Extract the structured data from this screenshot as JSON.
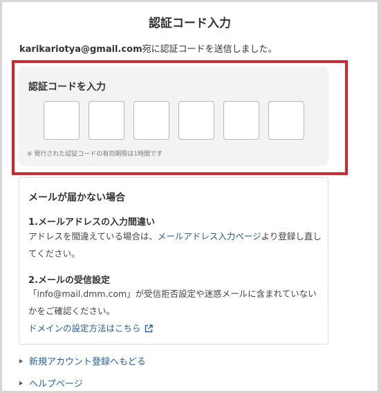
{
  "header": {
    "title": "認証コード入力"
  },
  "sent_message": {
    "email": "karikariotya@gmail.com",
    "suffix": "宛に認証コードを送信しました。"
  },
  "code_entry": {
    "label": "認証コードを入力",
    "cells": [
      "",
      "",
      "",
      "",
      "",
      ""
    ],
    "note": "※ 発行された認証コードの有効期限は1時間です"
  },
  "help": {
    "title": "メールが届かない場合",
    "section1": {
      "heading": "1.メールアドレスの入力間違い",
      "text_before": "アドレスを間違えている場合は、",
      "link": "メールアドレス入力ページ",
      "text_after": "より登録し直してください。"
    },
    "section2": {
      "heading": "2.メールの受信設定",
      "text": "「info@mail.dmm.com」が受信拒否設定や迷惑メールに含まれていないかをご確認ください。",
      "link": "ドメインの設定方法はこちら"
    }
  },
  "footer_links": [
    "新規アカウント登録へもどる",
    "ヘルプページ"
  ],
  "colors": {
    "highlight": "#d8232a",
    "link": "#2160a8",
    "panel": "#f3f3f3"
  },
  "icons": {
    "external": "external-link-icon",
    "bullet": "triangle-right-icon"
  }
}
